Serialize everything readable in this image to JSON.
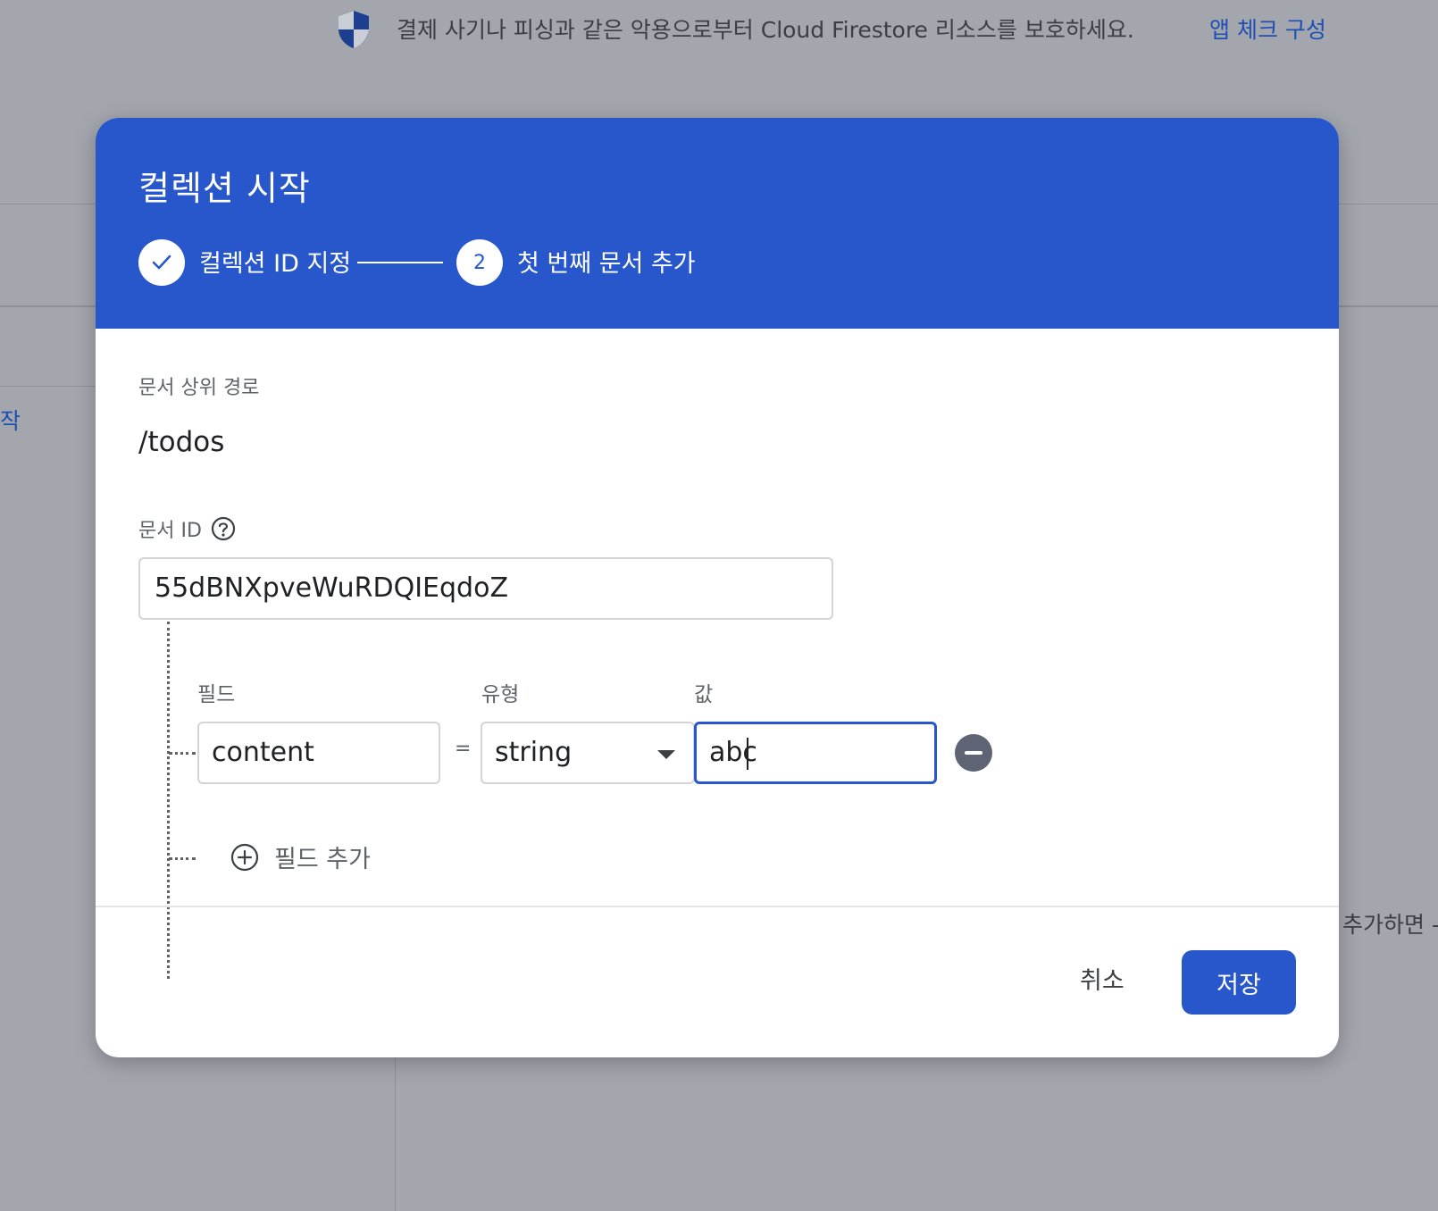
{
  "background": {
    "banner_text": "결제 사기나 피싱과 같은 악용으로부터 Cloud Firestore 리소스를 보호하세요.",
    "banner_link": "앱 체크 구성",
    "left_partial_text": "작",
    "right_partial_text": "추가하면 -"
  },
  "dialog": {
    "title": "컬렉션 시작",
    "steps": [
      {
        "label": "컬렉션 ID 지정",
        "state": "done"
      },
      {
        "number": "2",
        "label": "첫 번째 문서 추가",
        "state": "active"
      }
    ],
    "parent_path_label": "문서 상위 경로",
    "parent_path_value": "/todos",
    "document_id_label": "문서 ID",
    "document_id_value": "55dBNXpveWuRDQIEqdoZ",
    "columns": {
      "field": "필드",
      "type": "유형",
      "value": "값"
    },
    "field_row": {
      "field_name": "content",
      "equals": "=",
      "type": "string",
      "value": "abc"
    },
    "add_field_label": "필드 추가",
    "cancel_label": "취소",
    "save_label": "저장"
  },
  "colors": {
    "accent": "#2757cb",
    "overlay": "#a3a6ad",
    "remove_icon": "#5e6474"
  },
  "icons": [
    "shield-icon",
    "check-icon",
    "help-icon",
    "chevron-down-icon",
    "remove-circle-icon",
    "add-circle-icon"
  ]
}
